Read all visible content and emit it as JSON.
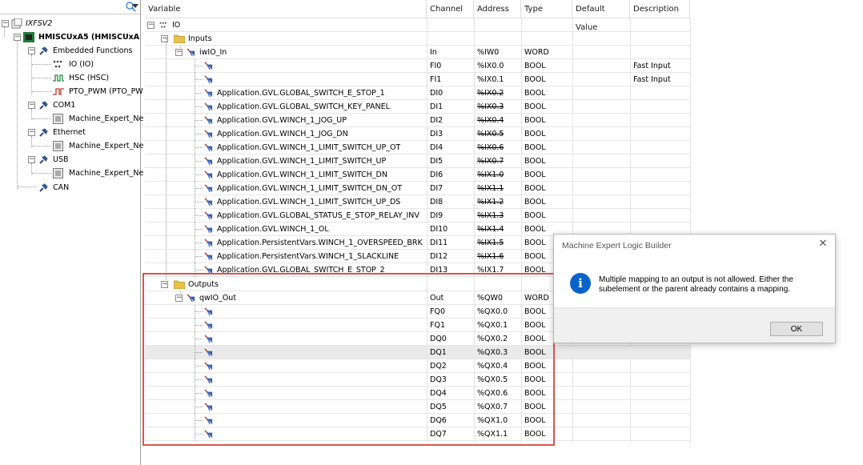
{
  "tree": {
    "root": "IXFSV2",
    "controller": "HMISCUxA5 (HMISCUxA",
    "embedded": "Embedded Functions",
    "io": "IO (IO)",
    "hsc": "HSC (HSC)",
    "pto": "PTO_PWM (PTO_PW",
    "com1": "COM1",
    "com1_child": "Machine_Expert_Ne",
    "ethernet": "Ethernet",
    "ethernet_child": "Machine_Expert_Ne",
    "usb": "USB",
    "usb_child": "Machine_Expert_Ne",
    "can": "CAN"
  },
  "grid": {
    "headers": {
      "variable": "Variable",
      "channel": "Channel",
      "address": "Address",
      "type": "Type",
      "default": "Default Value",
      "description": "Description"
    },
    "io_label": "IO",
    "inputs_label": "Inputs",
    "outputs_label": "Outputs",
    "input_rows": [
      {
        "variable": "iwIO_In",
        "channel": "In",
        "address": "%IW0",
        "type": "WORD",
        "description": ""
      },
      {
        "variable": "",
        "channel": "FI0",
        "address": "%IX0.0",
        "type": "BOOL",
        "description": "Fast Input"
      },
      {
        "variable": "",
        "channel": "FI1",
        "address": "%IX0.1",
        "type": "BOOL",
        "description": "Fast Input"
      },
      {
        "variable": "Application.GVL.GLOBAL_SWITCH_E_STOP_1",
        "channel": "DI0",
        "address": "%IX0.2",
        "type": "BOOL",
        "description": ""
      },
      {
        "variable": "Application.GVL.GLOBAL_SWITCH_KEY_PANEL",
        "channel": "DI1",
        "address": "%IX0.3",
        "type": "BOOL",
        "description": ""
      },
      {
        "variable": "Application.GVL.WINCH_1_JOG_UP",
        "channel": "DI2",
        "address": "%IX0.4",
        "type": "BOOL",
        "description": ""
      },
      {
        "variable": "Application.GVL.WINCH_1_JOG_DN",
        "channel": "DI3",
        "address": "%IX0.5",
        "type": "BOOL",
        "description": ""
      },
      {
        "variable": "Application.GVL.WINCH_1_LIMIT_SWITCH_UP_OT",
        "channel": "DI4",
        "address": "%IX0.6",
        "type": "BOOL",
        "description": ""
      },
      {
        "variable": "Application.GVL.WINCH_1_LIMIT_SWITCH_UP",
        "channel": "DI5",
        "address": "%IX0.7",
        "type": "BOOL",
        "description": ""
      },
      {
        "variable": "Application.GVL.WINCH_1_LIMIT_SWITCH_DN",
        "channel": "DI6",
        "address": "%IX1.0",
        "type": "BOOL",
        "description": ""
      },
      {
        "variable": "Application.GVL.WINCH_1_LIMIT_SWITCH_DN_OT",
        "channel": "DI7",
        "address": "%IX1.1",
        "type": "BOOL",
        "description": ""
      },
      {
        "variable": "Application.GVL.WINCH_1_LIMIT_SWITCH_UP_DS",
        "channel": "DI8",
        "address": "%IX1.2",
        "type": "BOOL",
        "description": ""
      },
      {
        "variable": "Application.GVL.GLOBAL_STATUS_E_STOP_RELAY_INV",
        "channel": "DI9",
        "address": "%IX1.3",
        "type": "BOOL",
        "description": ""
      },
      {
        "variable": "Application.GVL.WINCH_1_OL",
        "channel": "DI10",
        "address": "%IX1.4",
        "type": "BOOL",
        "description": ""
      },
      {
        "variable": "Application.PersistentVars.WINCH_1_OVERSPEED_BRK",
        "channel": "DI11",
        "address": "%IX1.5",
        "type": "BOOL",
        "description": ""
      },
      {
        "variable": "Application.PersistentVars.WINCH_1_SLACKLINE",
        "channel": "DI12",
        "address": "%IX1.6",
        "type": "BOOL",
        "description": ""
      },
      {
        "variable": "Application.GVL.GLOBAL_SWITCH_E_STOP_2",
        "channel": "DI13",
        "address": "%IX1.7",
        "type": "BOOL",
        "description": ""
      }
    ],
    "output_rows": [
      {
        "variable": "qwIO_Out",
        "channel": "Out",
        "address": "%QW0",
        "type": "WORD"
      },
      {
        "variable": "",
        "channel": "FQ0",
        "address": "%QX0.0",
        "type": "BOOL"
      },
      {
        "variable": "",
        "channel": "FQ1",
        "address": "%QX0.1",
        "type": "BOOL"
      },
      {
        "variable": "",
        "channel": "DQ0",
        "address": "%QX0.2",
        "type": "BOOL"
      },
      {
        "variable": "",
        "channel": "DQ1",
        "address": "%QX0.3",
        "type": "BOOL"
      },
      {
        "variable": "",
        "channel": "DQ2",
        "address": "%QX0.4",
        "type": "BOOL"
      },
      {
        "variable": "",
        "channel": "DQ3",
        "address": "%QX0.5",
        "type": "BOOL"
      },
      {
        "variable": "",
        "channel": "DQ4",
        "address": "%QX0.6",
        "type": "BOOL"
      },
      {
        "variable": "",
        "channel": "DQ5",
        "address": "%QX0.7",
        "type": "BOOL"
      },
      {
        "variable": "",
        "channel": "DQ6",
        "address": "%QX1.0",
        "type": "BOOL"
      },
      {
        "variable": "",
        "channel": "DQ7",
        "address": "%QX1.1",
        "type": "BOOL"
      }
    ]
  },
  "dialog": {
    "title": "Machine Expert Logic Builder",
    "message": "Multiple mapping to an output is not allowed. Either the subelement or the parent already contains a mapping.",
    "ok_label": "OK",
    "icon": "info-icon"
  },
  "colors": {
    "highlight_border": "#d9534f",
    "info_icon": "#0a63c9",
    "selected_row": "#eaeaea"
  }
}
